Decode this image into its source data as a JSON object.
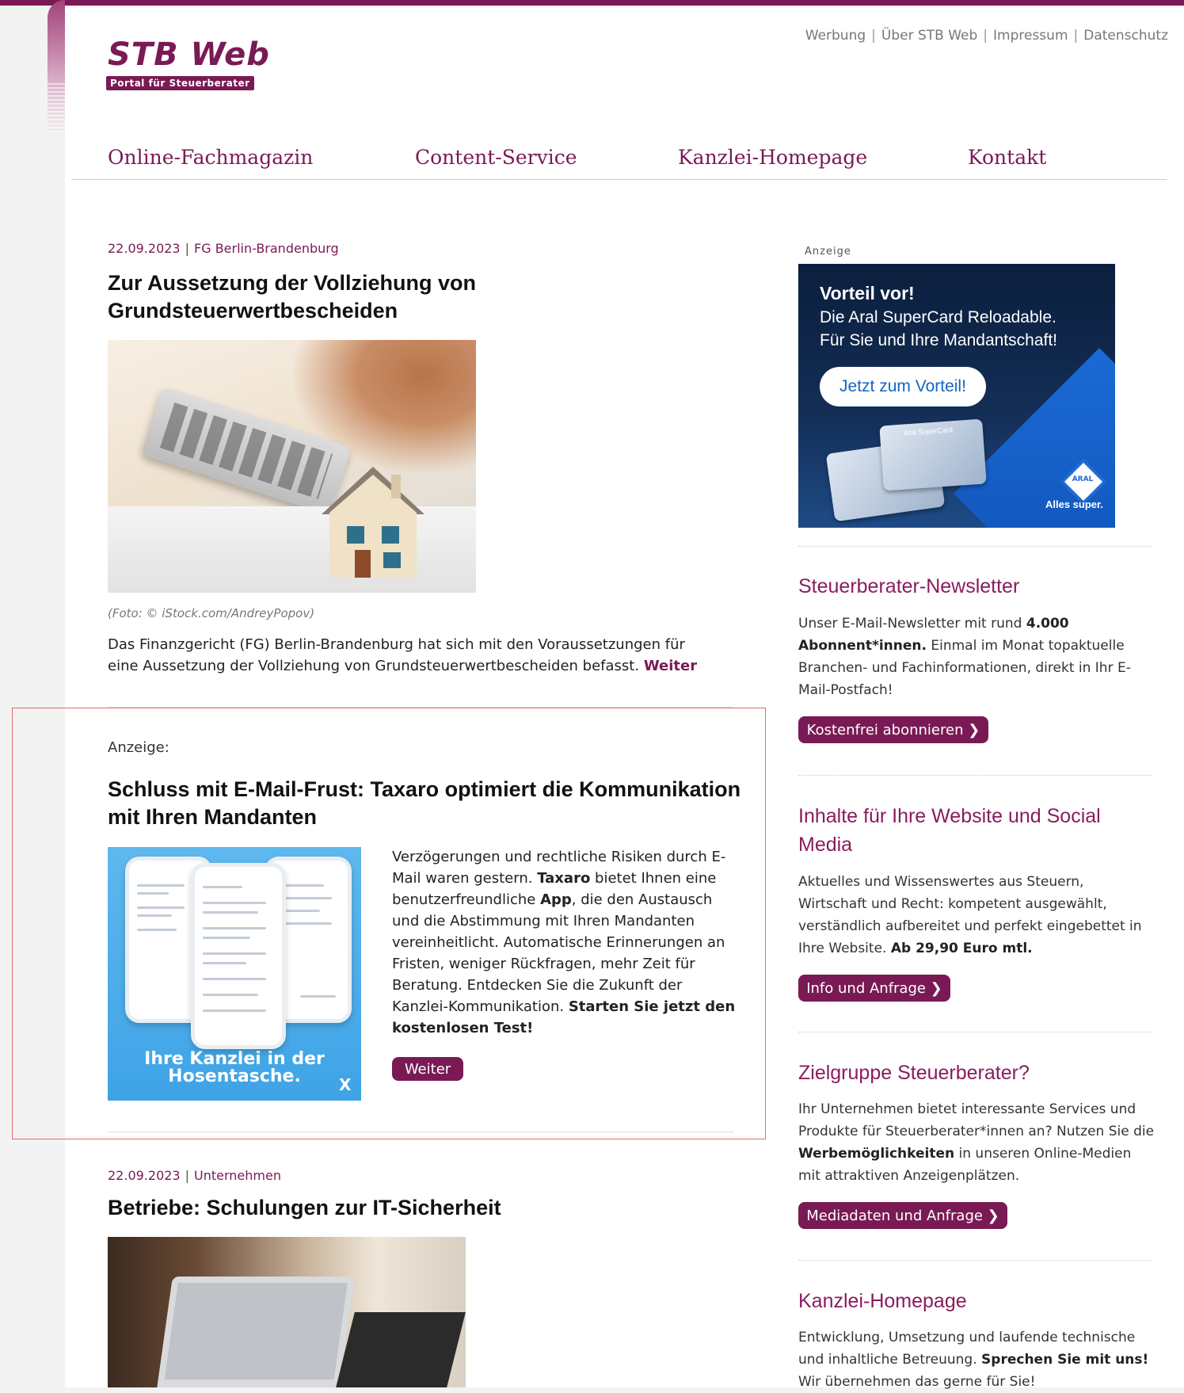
{
  "site": {
    "logo_title": "STB Web",
    "logo_subtitle": "Portal für Steuerberater",
    "accent_color": "#7a1a55"
  },
  "toplinks": [
    "Werbung",
    "Über STB Web",
    "Impressum",
    "Datenschutz"
  ],
  "nav": [
    "Online-Fachmagazin",
    "Content-Service",
    "Kanzlei-Homepage",
    "Kontakt"
  ],
  "article1": {
    "date": "22.09.2023",
    "category": "FG Berlin-Brandenburg",
    "title_line1": "Zur Aussetzung der Vollziehung von",
    "title_line2": "Grundsteuerwertbescheiden",
    "caption": "(Foto: © iStock.com/AndreyPopov)",
    "teaser_line1": "Das Finanzgericht (FG) Berlin-Brandenburg hat sich mit den Voraussetzungen für",
    "teaser_line2": "eine Aussetzung der Vollziehung von Grundsteuerwertbescheiden befasst.",
    "more": "Weiter"
  },
  "ad": {
    "label": "Anzeige:",
    "title_line1": "Schluss mit E-Mail-Frust: Taxaro optimiert die Kommunikation",
    "title_line2": "mit Ihren Mandanten",
    "body": [
      {
        "t": "Verzögerungen und rechtliche Risiken durch E-Mail waren gestern. ",
        "b": false
      },
      {
        "t": "Taxaro",
        "b": true
      },
      {
        "t": " bietet Ihnen eine benutzerfreundliche ",
        "b": false
      },
      {
        "t": "App",
        "b": true
      },
      {
        "t": ", die den Austausch und die Abstimmung mit Ihren Mandanten vereinheitlicht. Automatische Erinnerungen an Fristen, weniger Rückfragen, mehr Zeit für Beratung. Entdecken Sie die Zukunft der Kanzlei-Kommunikation. ",
        "b": false
      },
      {
        "t": "Starten Sie jetzt den kostenlosen Test!",
        "b": true
      }
    ],
    "button": "Weiter",
    "image_caption_line1": "Ihre Kanzlei in der",
    "image_caption_line2": "Hosentasche.",
    "image_close": "X"
  },
  "article2": {
    "date": "22.09.2023",
    "category": "Unternehmen",
    "title": "Betriebe: Schulungen zur IT-Sicherheit"
  },
  "sidebar": {
    "ad_small_label": "Anzeige",
    "aral": {
      "line1": "Vorteil vor!",
      "line2": "Die Aral SuperCard Reloadable.",
      "line3": "Für Sie und Ihre Mandantschaft!",
      "button": "Jetzt zum Vorteil!",
      "logo": "ARAL",
      "tagline": "Alles super.",
      "card_label": "Aral SuperCard"
    },
    "newsletter": {
      "heading": "Steuerberater-Newsletter",
      "text": [
        {
          "t": "Unser E-Mail-Newsletter mit rund ",
          "b": false
        },
        {
          "t": "4.000 Abonnent*innen.",
          "b": true
        },
        {
          "t": " Einmal im Monat topaktuelle Branchen- und Fachinformationen, direkt in Ihr E-Mail-Postfach!",
          "b": false
        }
      ],
      "button": "Kostenfrei abonnieren ❯"
    },
    "content": {
      "heading_line1": "Inhalte für Ihre Website und Social",
      "heading_line2": "Media",
      "text": [
        {
          "t": "Aktuelles und Wissenswertes aus Steuern, Wirtschaft und Recht: kompetent ausgewählt, verständlich aufbereitet und perfekt eingebettet in Ihre Website. ",
          "b": false
        },
        {
          "t": "Ab 29,90 Euro mtl.",
          "b": true
        }
      ],
      "button": "Info und Anfrage ❯"
    },
    "zielgruppe": {
      "heading": "Zielgruppe Steuerberater?",
      "text": [
        {
          "t": "Ihr Unternehmen bietet interessante Services und Produkte für Steuerberater*innen an? Nutzen Sie die ",
          "b": false
        },
        {
          "t": "Werbemöglichkeiten",
          "b": true
        },
        {
          "t": " in unseren Online-Medien mit attraktiven Anzeigenplätzen.",
          "b": false
        }
      ],
      "button": "Mediadaten und Anfrage ❯"
    },
    "homepage": {
      "heading": "Kanzlei-Homepage",
      "text": [
        {
          "t": "Entwicklung, Umsetzung und laufende technische und inhaltliche Betreuung. ",
          "b": false
        },
        {
          "t": "Sprechen Sie mit uns!",
          "b": true
        },
        {
          "t": " Wir übernehmen das gerne für Sie!",
          "b": false
        }
      ]
    }
  }
}
